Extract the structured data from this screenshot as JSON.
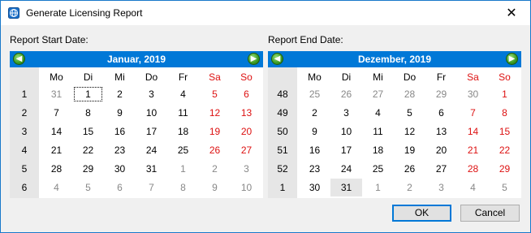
{
  "window": {
    "title": "Generate Licensing Report"
  },
  "start": {
    "label": "Report Start Date:",
    "month": "Januar",
    "year": "2019",
    "dow": [
      "Mo",
      "Di",
      "Mi",
      "Do",
      "Fr",
      "Sa",
      "So"
    ],
    "weeks": [
      "1",
      "2",
      "3",
      "4",
      "5",
      "6"
    ],
    "days": [
      [
        "31",
        "1",
        "2",
        "3",
        "4",
        "5",
        "6"
      ],
      [
        "7",
        "8",
        "9",
        "10",
        "11",
        "12",
        "13"
      ],
      [
        "14",
        "15",
        "16",
        "17",
        "18",
        "19",
        "20"
      ],
      [
        "21",
        "22",
        "23",
        "24",
        "25",
        "26",
        "27"
      ],
      [
        "28",
        "29",
        "30",
        "31",
        "1",
        "2",
        "3"
      ],
      [
        "4",
        "5",
        "6",
        "7",
        "8",
        "9",
        "10"
      ]
    ]
  },
  "end": {
    "label": "Report End Date:",
    "month": "Dezember",
    "year": "2019",
    "dow": [
      "Mo",
      "Di",
      "Mi",
      "Do",
      "Fr",
      "Sa",
      "So"
    ],
    "weeks": [
      "48",
      "49",
      "50",
      "51",
      "52",
      "1"
    ],
    "days": [
      [
        "25",
        "26",
        "27",
        "28",
        "29",
        "30",
        "1"
      ],
      [
        "2",
        "3",
        "4",
        "5",
        "6",
        "7",
        "8"
      ],
      [
        "9",
        "10",
        "11",
        "12",
        "13",
        "14",
        "15"
      ],
      [
        "16",
        "17",
        "18",
        "19",
        "20",
        "21",
        "22"
      ],
      [
        "23",
        "24",
        "25",
        "26",
        "27",
        "28",
        "29"
      ],
      [
        "30",
        "31",
        "1",
        "2",
        "3",
        "4",
        "5"
      ]
    ]
  },
  "buttons": {
    "ok": "OK",
    "cancel": "Cancel"
  },
  "colors": {
    "header": "#0078d7",
    "weekend": "#dd1111",
    "other_month": "#888888"
  }
}
